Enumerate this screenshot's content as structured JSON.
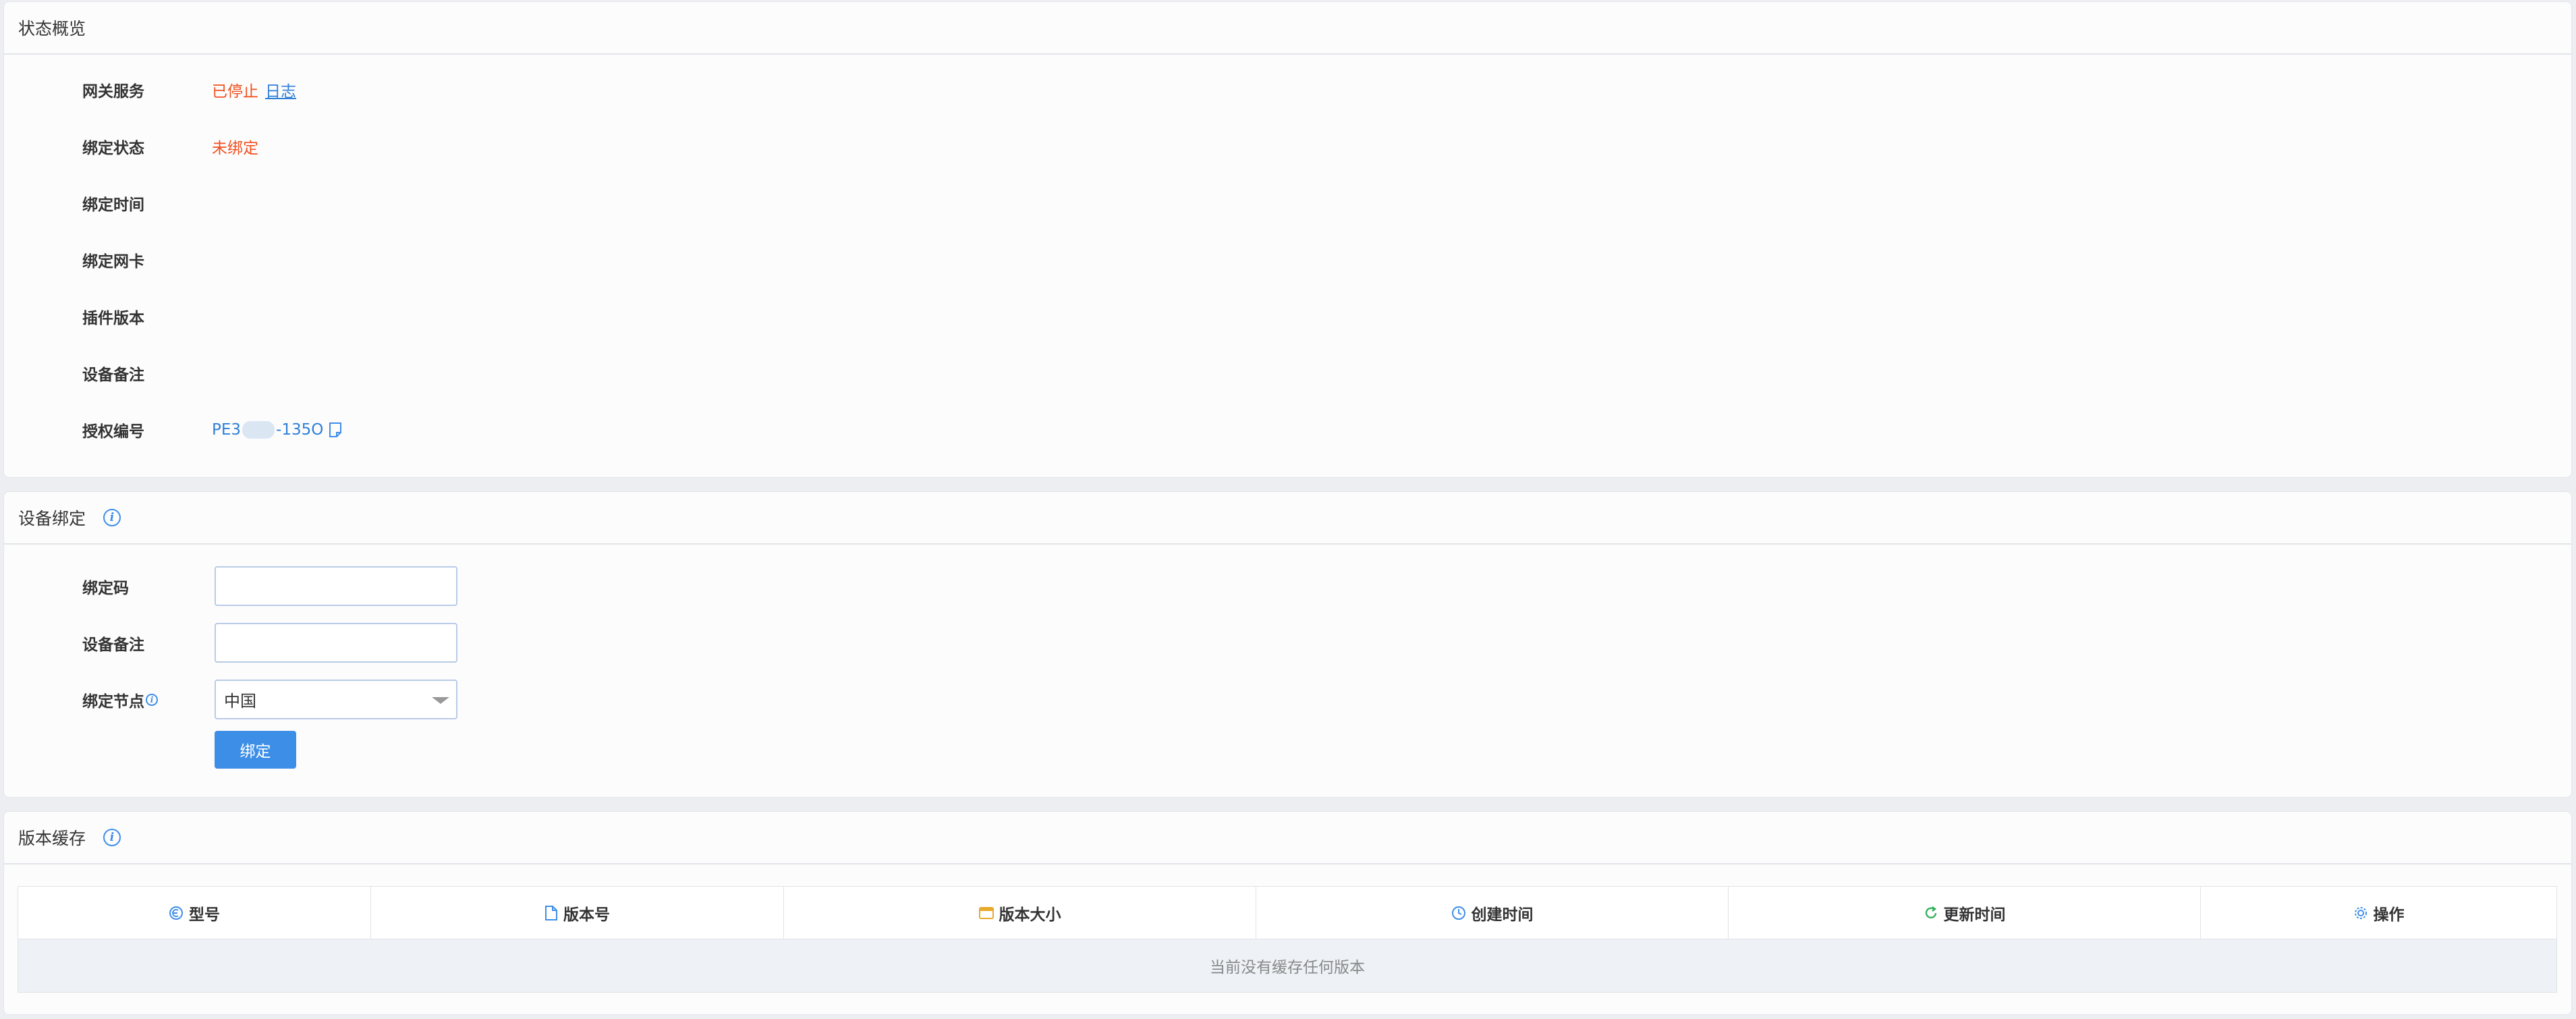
{
  "status_panel": {
    "title": "状态概览",
    "rows": [
      {
        "label": "网关服务",
        "value": "已停止",
        "link": "日志"
      },
      {
        "label": "绑定状态",
        "value": "未绑定"
      },
      {
        "label": "绑定时间",
        "value": ""
      },
      {
        "label": "绑定网卡",
        "value": ""
      },
      {
        "label": "插件版本",
        "value": ""
      },
      {
        "label": "设备备注",
        "value": ""
      },
      {
        "label": "授权编号",
        "value_prefix": "PE3",
        "value_suffix": "-135O"
      }
    ]
  },
  "bind_panel": {
    "title": "设备绑定",
    "bind_code_label": "绑定码",
    "bind_code_value": "",
    "remark_label": "设备备注",
    "remark_value": "",
    "node_label": "绑定节点",
    "node_selected": "中国",
    "bind_button": "绑定"
  },
  "cache_panel": {
    "title": "版本缓存",
    "columns": [
      {
        "label": "型号",
        "icon": "model-icon",
        "color": "#3f8ee8"
      },
      {
        "label": "版本号",
        "icon": "file-icon",
        "color": "#3f8ee8"
      },
      {
        "label": "版本大小",
        "icon": "folder-icon",
        "color": "#e8a92c"
      },
      {
        "label": "创建时间",
        "icon": "clock-icon",
        "color": "#3f8ee8"
      },
      {
        "label": "更新时间",
        "icon": "refresh-icon",
        "color": "#35b05a"
      },
      {
        "label": "操作",
        "icon": "gear-icon",
        "color": "#3f8ee8"
      }
    ],
    "empty_text": "当前没有缓存任何版本"
  },
  "colors": {
    "accent": "#3d8ee6",
    "stopped": "#f0501e",
    "link": "#2f7fd8"
  }
}
